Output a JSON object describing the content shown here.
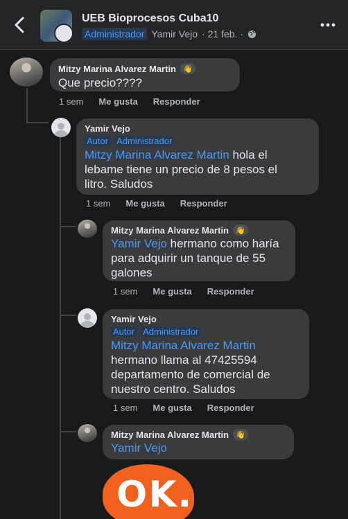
{
  "header": {
    "title": "UEB Bioprocesos Cuba10",
    "role_badge": "Administrador",
    "author": "Yamir Vejo",
    "date": "· 21 feb. ·",
    "privacy_icon": "globe-icon",
    "back_icon": "chevron-left-icon",
    "more_icon": "more-horizontal-icon"
  },
  "colors": {
    "background": "#18191a",
    "bubble": "#3a3b3c",
    "mention": "#4599ff",
    "badge_bg": "#263951",
    "sticker": "#f0611e"
  },
  "comments": [
    {
      "author": "Mitzy Marina Alvarez Martin",
      "reaction_icon": "wave-icon",
      "text": "Que precio????",
      "time": "1 sem",
      "like": "Me gusta",
      "reply": "Responder"
    },
    {
      "author": "Yamir Vejo",
      "badge_author": "Autor",
      "badge_admin": "Administrador",
      "mention": "Mitzy Marina Alvarez Martin",
      "text_line1": " hola el",
      "text_line2": "lebame tiene un precio de 8 pesos el",
      "text_line3": "litro. Saludos",
      "time": "1 sem",
      "like": "Me gusta",
      "reply": "Responder"
    },
    {
      "author": "Mitzy Marina Alvarez Martin",
      "reaction_icon": "wave-icon",
      "mention": "Yamir Vejo",
      "text_line1": " hermano como haría",
      "text_line2": "para adquirir un tanque de 55",
      "text_line3": "galones",
      "time": "1 sem",
      "like": "Me gusta",
      "reply": "Responder"
    },
    {
      "author": "Yamir Vejo",
      "badge_author": "Autor",
      "badge_admin": "Administrador",
      "mention": "Mitzy Marina Alvarez Martin",
      "text_line2": "hermano llama al 47425594",
      "text_line3": "departamento de comercial de",
      "text_line4": "nuestro centro. Saludos",
      "time": "1 sem",
      "like": "Me gusta",
      "reply": "Responder"
    },
    {
      "author": "Mitzy Marina Alvarez Martin",
      "reaction_icon": "wave-icon",
      "mention": "Yamir Vejo"
    }
  ],
  "sticker": {
    "text": "OK."
  }
}
